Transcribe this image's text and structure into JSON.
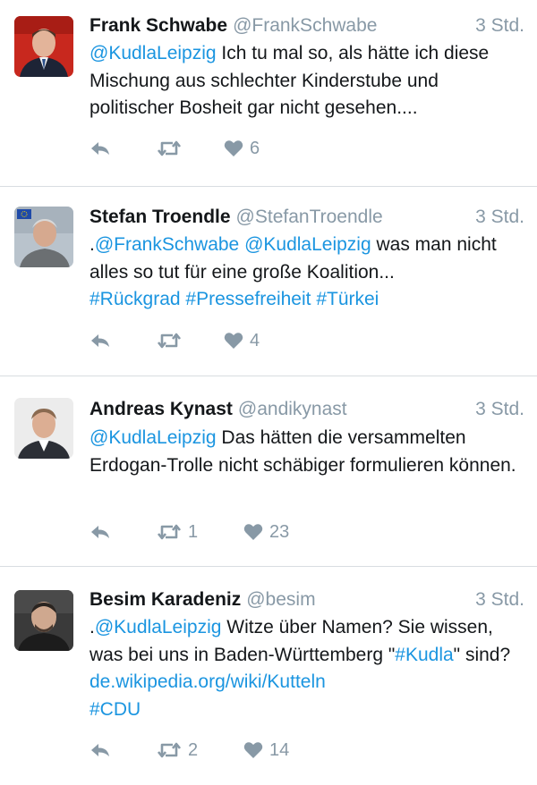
{
  "tweets": [
    {
      "name": "Frank Schwabe",
      "handle": "@FrankSchwabe",
      "time": "3 Std.",
      "mention": "@KudlaLeipzig",
      "text": " Ich tu mal so, als hätte ich diese Mischung aus schlechter Kinderstube und politischer Bosheit gar nicht gesehen....",
      "retweets": "",
      "likes": "6"
    },
    {
      "name": "Stefan Troendle",
      "handle": "@StefanTroendle",
      "time": "3 Std.",
      "prefix": ".",
      "mention1": "@FrankSchwabe",
      "mention2": "@KudlaLeipzig",
      "text": " was man nicht alles so tut für eine große Koalition...",
      "hashtag1": "#Rückgrad",
      "hashtag2": "#Pressefreiheit",
      "hashtag3": "#Türkei",
      "retweets": "",
      "likes": "4"
    },
    {
      "name": "Andreas Kynast",
      "handle": "@andikynast",
      "time": "3 Std.",
      "mention": "@KudlaLeipzig",
      "text": " Das hätten die versammelten Erdogan-Trolle nicht schäbiger formulieren können.",
      "retweets": "1",
      "likes": "23"
    },
    {
      "name": "Besim Karadeniz",
      "handle": "@besim",
      "time": "3 Std.",
      "prefix": ".",
      "mention": "@KudlaLeipzig",
      "text1": " Witze über Namen? Sie wissen, was bei uns in Baden-Württemberg \"",
      "hashtag_kudla": "#Kudla",
      "text2": "\" sind? ",
      "link": "de.wikipedia.org/wiki/Kutteln",
      "hashtag_cdu": "#CDU",
      "retweets": "2",
      "likes": "14"
    }
  ],
  "colors": {
    "link": "#1b95e0",
    "muted": "#8899a6",
    "text": "#14171a",
    "separator": "#d8dde1"
  },
  "icons": [
    "reply-icon",
    "retweet-icon",
    "heart-icon"
  ]
}
